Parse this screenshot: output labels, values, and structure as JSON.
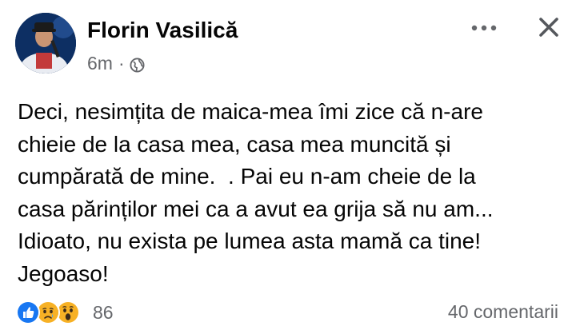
{
  "post": {
    "author": "Florin Vasilică",
    "time": "6m",
    "meta_separator": "·",
    "privacy_icon": "globe-icon",
    "more_icon": "more-horizontal-icon",
    "close_icon": "close-icon",
    "text_lines": [
      "Deci, nesimțita de maica-mea îmi zice că n-are",
      "chieie de la casa mea, casa mea muncită și",
      "cumpărată de mine.  . Pai eu n-am cheie de la",
      "casa părinților mei ca a avut ea grija să nu am...",
      "Idioato, nu exista pe lumea asta mamă ca tine!",
      "Jegoaso!"
    ],
    "reactions": {
      "icons": [
        "like-icon",
        "sad-icon",
        "wow-icon"
      ],
      "count": "86"
    },
    "comments": "40 comentarii"
  },
  "colors": {
    "name_text": "#050505",
    "secondary_text": "#65676b",
    "like_blue": "#1877f2",
    "emoji_yellow": "#f7b125",
    "background": "#ffffff"
  }
}
